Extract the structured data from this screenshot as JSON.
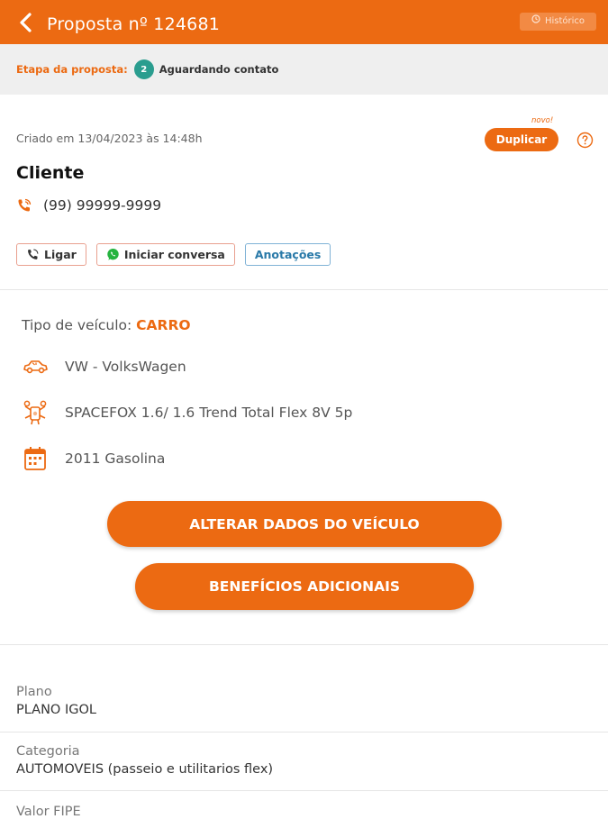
{
  "header": {
    "title": "Proposta nº 124681",
    "history_label": "Histórico"
  },
  "stage": {
    "label": "Etapa da proposta:",
    "number": "2",
    "text": "Aguardando contato"
  },
  "client": {
    "created": "Criado em 13/04/2023 às 14:48h",
    "new_badge": "novo!",
    "duplicate_label": "Duplicar",
    "name": "Cliente",
    "phone": "(99) 99999-9999"
  },
  "actions": {
    "call_label": "Ligar",
    "chat_label": "Iniciar conversa",
    "notes_label": "Anotações"
  },
  "vehicle": {
    "type_label": "Tipo de veículo:",
    "type_value": "CARRO",
    "brand": "VW - VolksWagen",
    "model": "SPACEFOX 1.6/ 1.6 Trend Total Flex 8V 5p",
    "year": "2011 Gasolina"
  },
  "buttons": {
    "edit_vehicle": "ALTERAR DADOS DO VEÍCULO",
    "extra_benefits": "BENEFÍCIOS ADICIONAIS"
  },
  "info": {
    "plan_label": "Plano",
    "plan_value": "PLANO IGOL",
    "category_label": "Categoria",
    "category_value": "AUTOMOVEIS (passeio e utilitarios flex)",
    "next_label": "Valor FIPE"
  },
  "colors": {
    "brand": "#ec6a12",
    "stage_badge": "#2a9d8f",
    "notes_blue": "#2979a8"
  }
}
